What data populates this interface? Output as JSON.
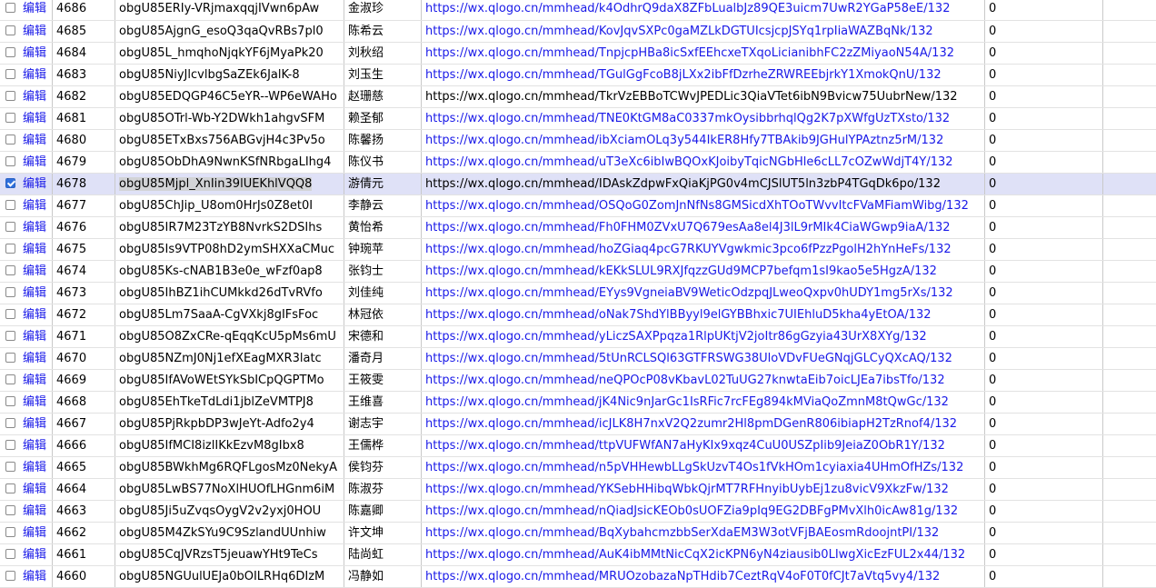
{
  "edit_label": "编辑",
  "colors": {
    "link": "#1a1ae8",
    "selected_row": "#dfe1f7",
    "checkbox_checked": "#2f6fdb"
  },
  "rows": [
    {
      "id": "4686",
      "openid": "obgU85ERIy-VRjmaxqqjIVwn6pAw",
      "name": "金淑珍",
      "url": "https://wx.qlogo.cn/mmhead/k4OdhrQ9daX8ZFbLualbJz89QE3uicm7UwR2YGaP58eE/132",
      "value": "0",
      "checked": false,
      "link": true
    },
    {
      "id": "4685",
      "openid": "obgU85AjgnG_esoQ3qaQvRBs7pl0",
      "name": "陈希云",
      "url": "https://wx.qlogo.cn/mmhead/KovJqvSXPc0gaMZLkDGTUIcsjcpJSYq1rpIiaWAZBqNk/132",
      "value": "0",
      "checked": false,
      "link": true
    },
    {
      "id": "4684",
      "openid": "obgU85L_hmqhoNjqkYF6jMyaPk20",
      "name": "刘秋绍",
      "url": "https://wx.qlogo.cn/mmhead/TnpjcpHBa8icSxfEEhcxeTXqoLicianibhFC2zZMiyaoN54A/132",
      "value": "0",
      "checked": false,
      "link": true
    },
    {
      "id": "4683",
      "openid": "obgU85NiyJlcvlbgSaZEk6JalK-8",
      "name": "刘玉生",
      "url": "https://wx.qlogo.cn/mmhead/TGulGgFcoB8jLXx2ibFfDzrheZRWREEbjrkY1XmokQnU/132",
      "value": "0",
      "checked": false,
      "link": true
    },
    {
      "id": "4682",
      "openid": "obgU85EDQGP46C5eYR--WP6eWAHo",
      "name": "赵珊慈",
      "url": "https://wx.qlogo.cn/mmhead/TkrVzEBBoTCWvJPEDLic3QiaVTet6ibN9Bvicw75UubrNew/132",
      "value": "0",
      "checked": false,
      "link": false
    },
    {
      "id": "4681",
      "openid": "obgU85OTrl-Wb-Y2DWkh1ahgvSFM",
      "name": "赖圣郁",
      "url": "https://wx.qlogo.cn/mmhead/TNE0KtGM8aC0337mkOysibbrhqlQg2K7pXWfgUzTXsto/132",
      "value": "0",
      "checked": false,
      "link": true
    },
    {
      "id": "4680",
      "openid": "obgU85ETxBxs756ABGvjH4c3Pv5o",
      "name": "陈馨扬",
      "url": "https://wx.qlogo.cn/mmhead/ibXciamOLq3y544IkER8Hfy7TBAkib9JGHulYPAztnz5rM/132",
      "value": "0",
      "checked": false,
      "link": true
    },
    {
      "id": "4679",
      "openid": "obgU85ObDhA9NwnKSfNRbgaLIhg4",
      "name": "陈仪书",
      "url": "https://wx.qlogo.cn/mmhead/uT3eXc6ibIwBQOxKJoibyTqicNGbHle6cLL7cOZwWdjT4Y/132",
      "value": "0",
      "checked": false,
      "link": true
    },
    {
      "id": "4678",
      "openid": "obgU85Mjpl_XnIin39lUEKhlVQQ8",
      "name": "游倩元",
      "url": "https://wx.qlogo.cn/mmhead/IDAskZdpwFxQiaKjPG0v4mCJSlUT5ln3zbP4TGqDk6po/132",
      "value": "0",
      "checked": true,
      "link": false
    },
    {
      "id": "4677",
      "openid": "obgU85ChJip_U8om0HrJs0Z8et0I",
      "name": "李静云",
      "url": "https://wx.qlogo.cn/mmhead/OSQoG0ZomJnNfNs8GMSicdXhTOoTWvvItcFVaMFiamWibg/132",
      "value": "0",
      "checked": false,
      "link": true
    },
    {
      "id": "4676",
      "openid": "obgU85IR7M23TzYB8NvrkS2DSIhs",
      "name": "黄怡希",
      "url": "https://wx.qlogo.cn/mmhead/Fh0FHM0ZVxU7Q679esAa8el4J3lL9rMIk4CiaWGwp9iaA/132",
      "value": "0",
      "checked": false,
      "link": true
    },
    {
      "id": "4675",
      "openid": "obgU85Is9VTP08hD2ymSHXXaCMuc",
      "name": "钟琬苹",
      "url": "https://wx.qlogo.cn/mmhead/hoZGiaq4pcG7RKUYVgwkmic3pco6fPzzPgolH2hYnHeFs/132",
      "value": "0",
      "checked": false,
      "link": true
    },
    {
      "id": "4674",
      "openid": "obgU85Ks-cNAB1B3e0e_wFzf0ap8",
      "name": "张钧士",
      "url": "https://wx.qlogo.cn/mmhead/kEKkSLUL9RXJfqzzGUd9MCP7befqm1sI9kao5e5HgzA/132",
      "value": "0",
      "checked": false,
      "link": true
    },
    {
      "id": "4673",
      "openid": "obgU85IhBZ1ihCUMkkd26dTvRVfo",
      "name": "刘佳纯",
      "url": "https://wx.qlogo.cn/mmhead/EYys9VgneiaBV9WeticOdzpqJLweoQxpv0hUDY1mg5rXs/132",
      "value": "0",
      "checked": false,
      "link": true
    },
    {
      "id": "4672",
      "openid": "obgU85Lm7SaaA-CgVXkj8gIFsFoc",
      "name": "林冠依",
      "url": "https://wx.qlogo.cn/mmhead/oNak7ShdYlBByyl9elGYBBhxic7UIEhluD5kha4yEtOA/132",
      "value": "0",
      "checked": false,
      "link": true
    },
    {
      "id": "4671",
      "openid": "obgU85O8ZxCRe-qEqqKcU5pMs6mU",
      "name": "宋德和",
      "url": "https://wx.qlogo.cn/mmhead/yLiczSAXPpqza1RlpUKtjV2joItr86gGzyia43UrX8XYg/132",
      "value": "0",
      "checked": false,
      "link": true
    },
    {
      "id": "4670",
      "openid": "obgU85NZmJ0Nj1efXEagMXR3latc",
      "name": "潘奇月",
      "url": "https://wx.qlogo.cn/mmhead/5tUnRCLSQl63GTFRSWG38UloVDvFUeGNqjGLCyQXcAQ/132",
      "value": "0",
      "checked": false,
      "link": true
    },
    {
      "id": "4669",
      "openid": "obgU85IfAVoWEtSYkSbICpQGPTMo",
      "name": "王筱雯",
      "url": "https://wx.qlogo.cn/mmhead/neQPOcP08vKbavL02TuUG27knwtaEib7oicLJEa7ibsTfo/132",
      "value": "0",
      "checked": false,
      "link": true
    },
    {
      "id": "4668",
      "openid": "obgU85EhTkeTdLdi1jblZeVMTPJ8",
      "name": "王维喜",
      "url": "https://wx.qlogo.cn/mmhead/jK4Nic9nJarGc1IsRFic7rcFEg894kMViaQoZmnM8tQwGc/132",
      "value": "0",
      "checked": false,
      "link": true
    },
    {
      "id": "4667",
      "openid": "obgU85PjRkpbDP3wJeYt-Adfo2y4",
      "name": "谢志宇",
      "url": "https://wx.qlogo.cn/mmhead/icJLK8H7nxV2Q2zumr2Hl8pmDGenR806ibiapH2TzRnof4/132",
      "value": "0",
      "checked": false,
      "link": true
    },
    {
      "id": "4666",
      "openid": "obgU85IfMCI8izlIKkEzvM8gIbx8",
      "name": "王儒桦",
      "url": "https://wx.qlogo.cn/mmhead/ttpVUFWfAN7aHyKIx9xqz4CuU0USZpIib9JeiaZ0ObR1Y/132",
      "value": "0",
      "checked": false,
      "link": true
    },
    {
      "id": "4665",
      "openid": "obgU85BWkhMg6RQFLgosMz0NekyA",
      "name": "侯钧芬",
      "url": "https://wx.qlogo.cn/mmhead/n5pVHHewbLLgSkUzvT4Os1fVkHOm1cyiaxia4UHmOfHZs/132",
      "value": "0",
      "checked": false,
      "link": true
    },
    {
      "id": "4664",
      "openid": "obgU85LwBS77NoXlHUOfLHGnm6iM",
      "name": "陈淑芬",
      "url": "https://wx.qlogo.cn/mmhead/YKSebHHibqWbkQjrMT7RFHnyibUybEj1zu8vicV9XkzFw/132",
      "value": "0",
      "checked": false,
      "link": true
    },
    {
      "id": "4663",
      "openid": "obgU85Ji5uZvqsOygV2v2yxj0HOU",
      "name": "陈嘉卿",
      "url": "https://wx.qlogo.cn/mmhead/nQiadJsicKEOb0sUOFZia9pIq9EG2DBFgPMvXlh0icAw81g/132",
      "value": "0",
      "checked": false,
      "link": true
    },
    {
      "id": "4662",
      "openid": "obgU85M4ZkSYu9C9SzlandUUnhiw",
      "name": "许文坤",
      "url": "https://wx.qlogo.cn/mmhead/BqXybahcmzbbSerXdaEM3W3otVFjBAEosmRdoojntPI/132",
      "value": "0",
      "checked": false,
      "link": true
    },
    {
      "id": "4661",
      "openid": "obgU85CqJVRzsT5jeuawYHt9TeCs",
      "name": "陆尚虹",
      "url": "https://wx.qlogo.cn/mmhead/AuK4ibMMtNicCqX2icKPN6yN4ziausib0LIwgXicEzFUL2x44/132",
      "value": "0",
      "checked": false,
      "link": true
    },
    {
      "id": "4660",
      "openid": "obgU85NGUulUEJa0bOILRHq6DIzM",
      "name": "冯静如",
      "url": "https://wx.qlogo.cn/mmhead/MRUOzobazaNpTHdib7CeztRqV4oF0T0fCJt7aVtq5vy4/132",
      "value": "0",
      "checked": false,
      "link": true
    }
  ]
}
